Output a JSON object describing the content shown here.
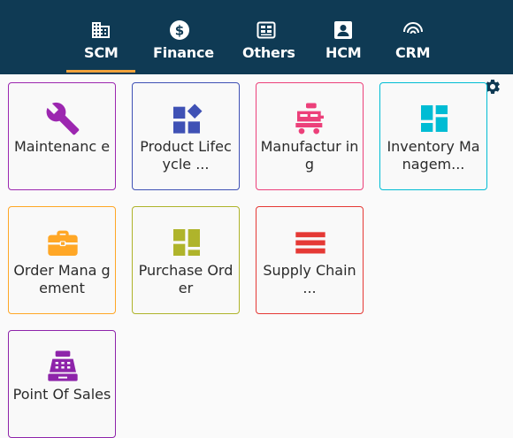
{
  "tabs": [
    {
      "label": "SCM",
      "icon": "building-icon",
      "active": true
    },
    {
      "label": "Finance",
      "icon": "dollar-icon",
      "active": false
    },
    {
      "label": "Others",
      "icon": "ledger-icon",
      "active": false
    },
    {
      "label": "HCM",
      "icon": "person-badge-icon",
      "active": false
    },
    {
      "label": "CRM",
      "icon": "signal-icon",
      "active": false
    }
  ],
  "settings_icon": "gear-icon",
  "cards": [
    {
      "label": "Maintenanc e",
      "icon": "wrench-icon",
      "color": "#9c27b0"
    },
    {
      "label": "Product Lifecycle ...",
      "icon": "shapes-icon",
      "color": "#3f51b5"
    },
    {
      "label": "Manufactur ing",
      "icon": "production-icon",
      "color": "#ec407a"
    },
    {
      "label": "Inventory Managem...",
      "icon": "dashboard-icon",
      "color": "#00bcd4"
    },
    {
      "label": "Order Mana gement",
      "icon": "briefcase-icon",
      "color": "#ffa726"
    },
    {
      "label": "Purchase Order",
      "icon": "grid-icon",
      "color": "#afb42b"
    },
    {
      "label": "Supply Chain ...",
      "icon": "stack-icon",
      "color": "#e53935"
    },
    {
      "label": "Point Of Sales",
      "icon": "cash-register-icon",
      "color": "#8e24aa"
    }
  ],
  "colors": {
    "topbar": "#0f3a54",
    "active_underline": "#f0a13a"
  }
}
